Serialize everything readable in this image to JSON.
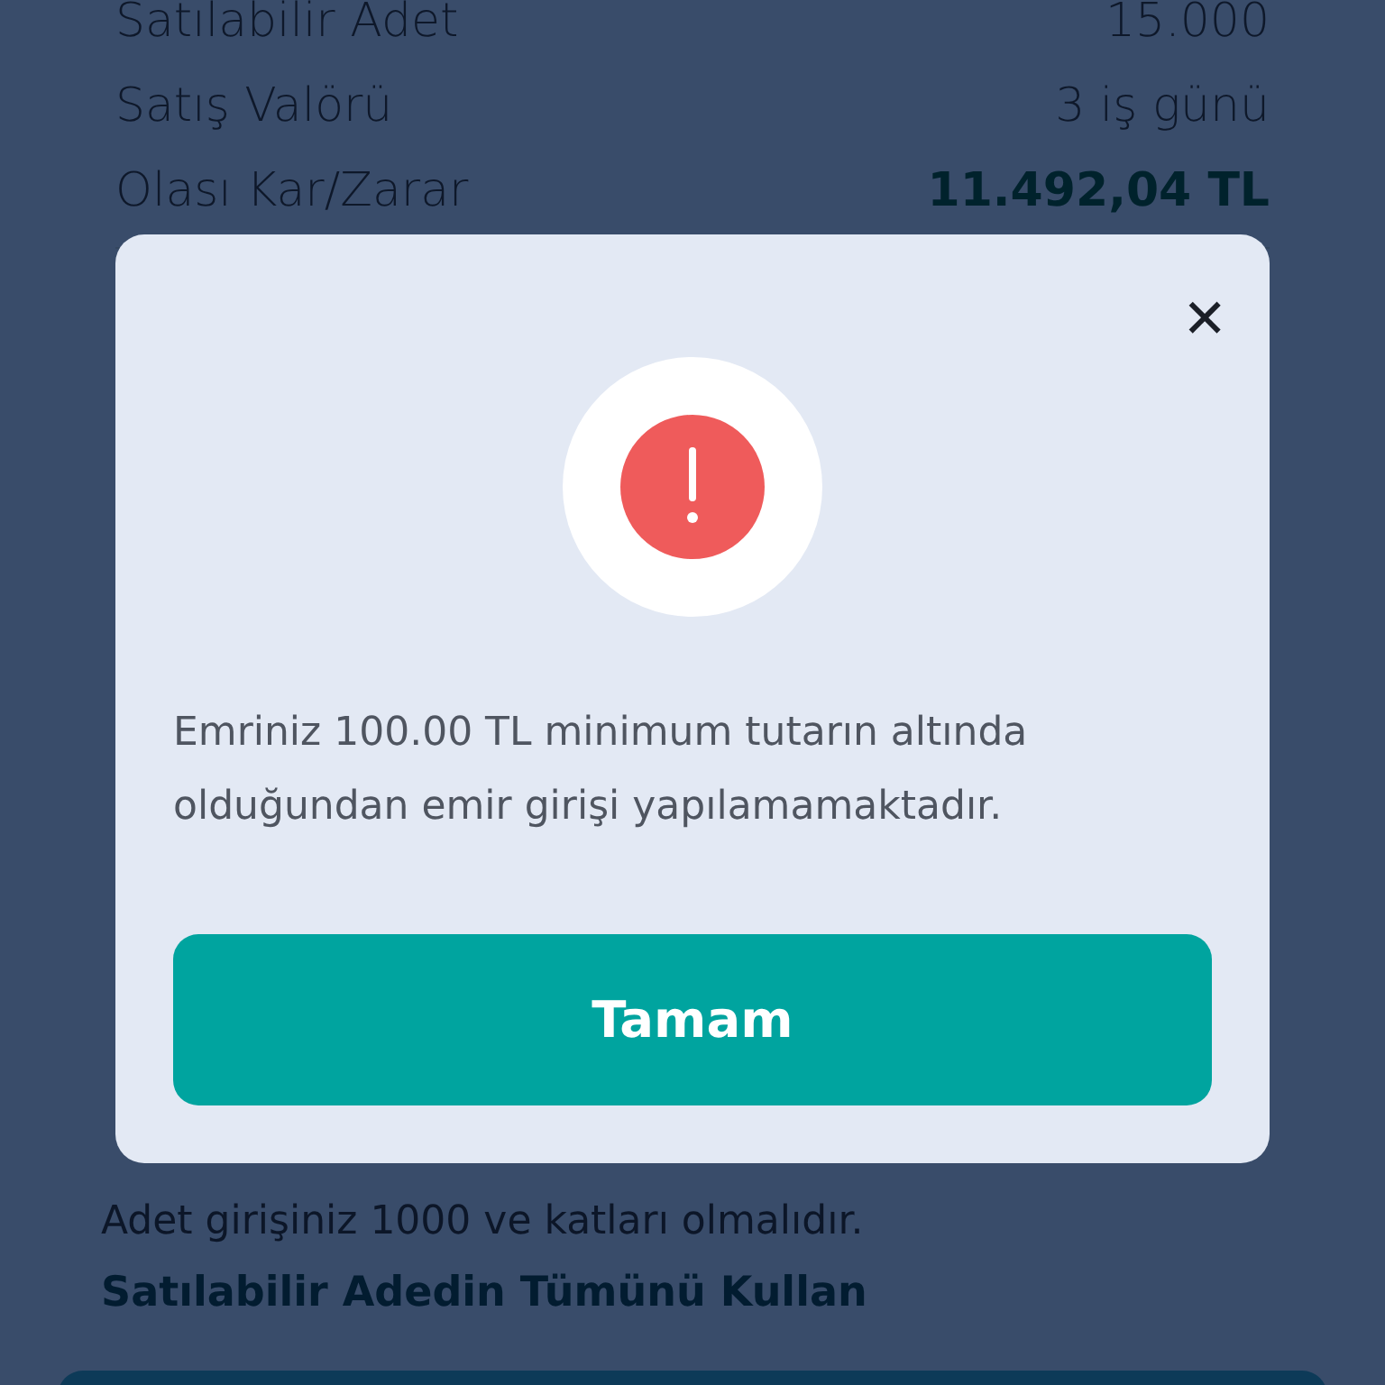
{
  "summary_rows": [
    {
      "label": "Satılabilir Adet",
      "value": "15.000",
      "kind": "plain"
    },
    {
      "label": "Satış Valörü",
      "value": "3 iş günü",
      "kind": "plain"
    },
    {
      "label": "Olası Kar/Zarar",
      "value": "11.492,04 TL",
      "kind": "profit"
    }
  ],
  "note": "Adet girişiniz 1000 ve katları olmalıdır.",
  "use_all_link": "Satılabilir Adedin Tümünü Kullan",
  "dialog": {
    "close": "✕",
    "message": "Emriniz 100.00 TL minimum tutarın altında olduğundan emir girişi yapılamamaktadır.",
    "button": "Tamam"
  }
}
